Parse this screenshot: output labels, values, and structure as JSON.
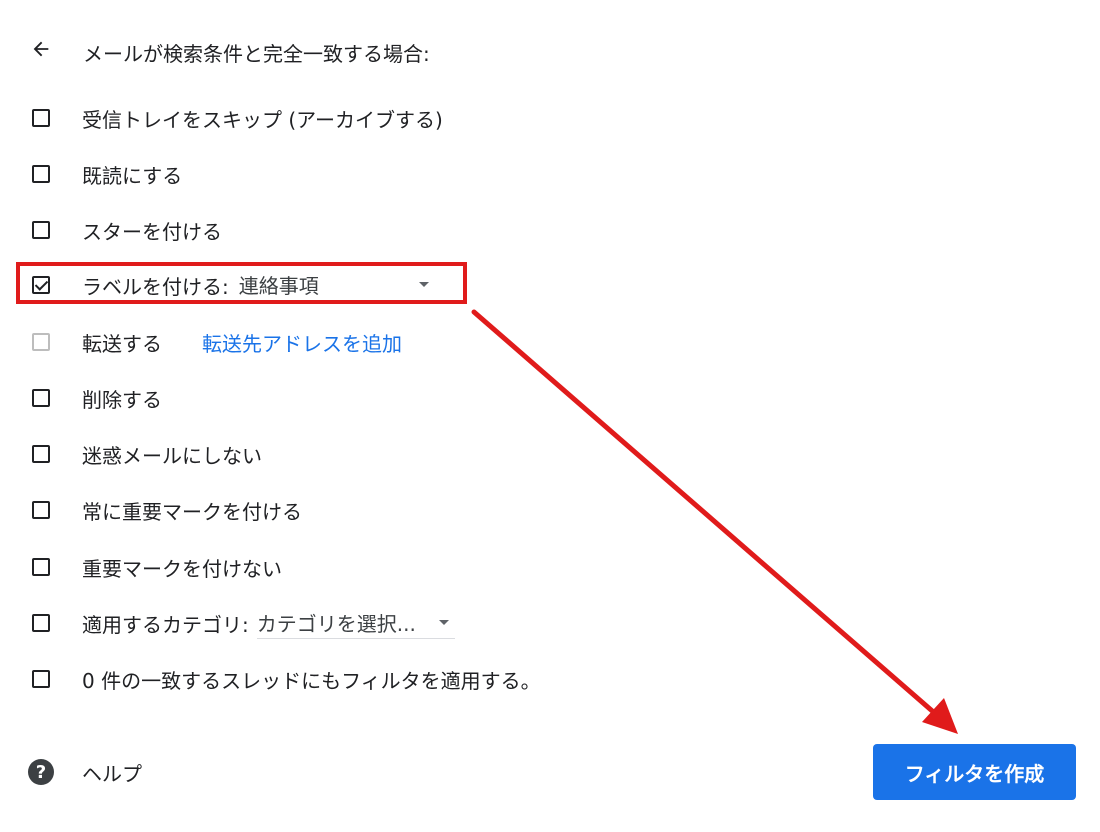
{
  "header": {
    "title": "メールが検索条件と完全一致する場合:"
  },
  "options": [
    {
      "label": "受信トレイをスキップ (アーカイブする)",
      "checked": false
    },
    {
      "label": "既読にする",
      "checked": false
    },
    {
      "label": "スターを付ける",
      "checked": false
    },
    {
      "label": "ラベルを付ける:",
      "checked": true,
      "select_value": "連絡事項"
    },
    {
      "label": "転送する",
      "checked": false,
      "disabled": true,
      "link": "転送先アドレスを追加"
    },
    {
      "label": "削除する",
      "checked": false
    },
    {
      "label": "迷惑メールにしない",
      "checked": false
    },
    {
      "label": "常に重要マークを付ける",
      "checked": false
    },
    {
      "label": "重要マークを付けない",
      "checked": false
    },
    {
      "label": "適用するカテゴリ:",
      "checked": false,
      "select_value": "カテゴリを選択..."
    },
    {
      "label": "0 件の一致するスレッドにもフィルタを適用する。",
      "checked": false
    }
  ],
  "footer": {
    "help_icon_text": "?",
    "help_label": "ヘルプ",
    "create_button_label": "フィルタを作成"
  },
  "colors": {
    "accent": "#1a73e8",
    "annotation": "#e01b1b"
  }
}
